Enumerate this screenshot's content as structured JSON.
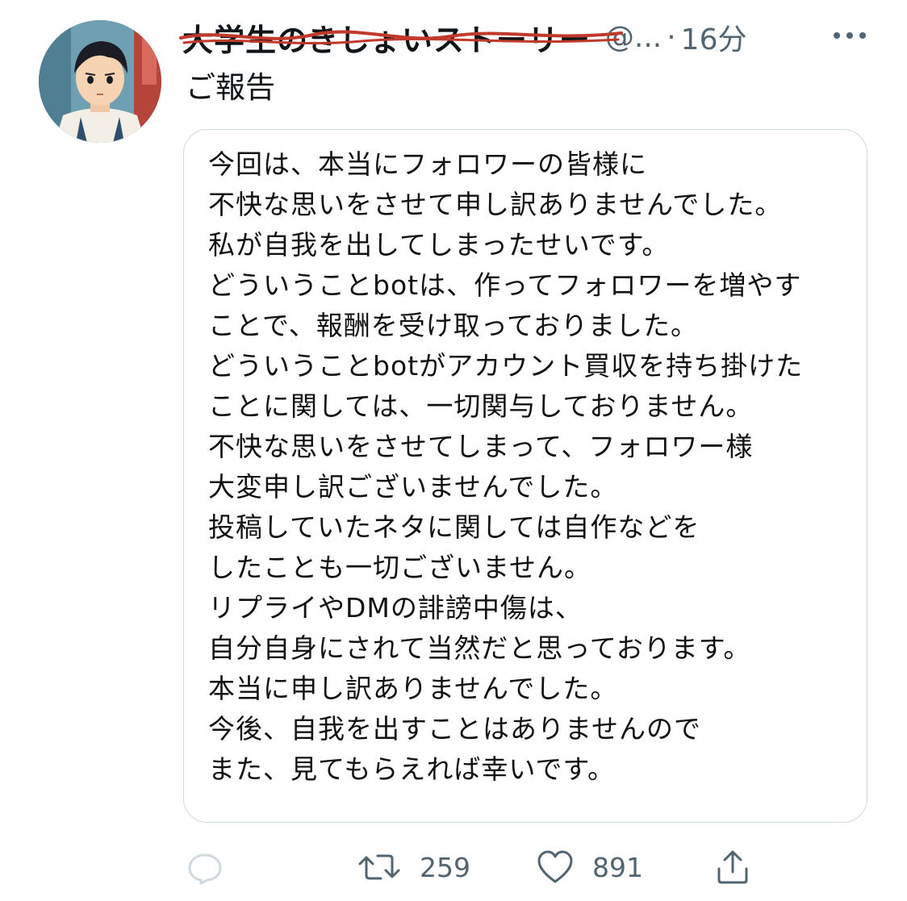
{
  "tweet": {
    "display_name": "大学生のきしょいストーリー",
    "handle": "@...",
    "separator": "·",
    "time": "16分",
    "text": "ご報告"
  },
  "image_card": {
    "lines": [
      "今回は、本当にフォロワーの皆様に",
      "不快な思いをさせて申し訳ありませんでした。",
      "私が自我を出してしまったせいです。",
      "どういうことbotは、作ってフォロワーを増やす",
      "ことで、報酬を受け取っておりました。",
      "どういうことbotがアカウント買収を持ち掛けた",
      "ことに関しては、一切関与しておりません。",
      "不快な思いをさせてしまって、フォロワー様",
      "大変申し訳ございませんでした。",
      "投稿していたネタに関しては自作などを",
      "したことも一切ございません。",
      "リプライやDMの誹謗中傷は、",
      "自分自身にされて当然だと思っております。",
      "本当に申し訳ありませんでした。",
      "今後、自我を出すことはありませんので",
      "また、見てもらえれば幸いです。"
    ]
  },
  "actions": {
    "retweet_count": "259",
    "like_count": "891"
  },
  "icons": {
    "more": "more-horizontal-icon",
    "reply": "reply-icon",
    "retweet": "retweet-icon",
    "like": "heart-icon",
    "share": "share-icon"
  },
  "colors": {
    "text": "#0f1419",
    "secondary": "#536471",
    "border": "#cfd9de",
    "scribble": "#c0392b"
  }
}
